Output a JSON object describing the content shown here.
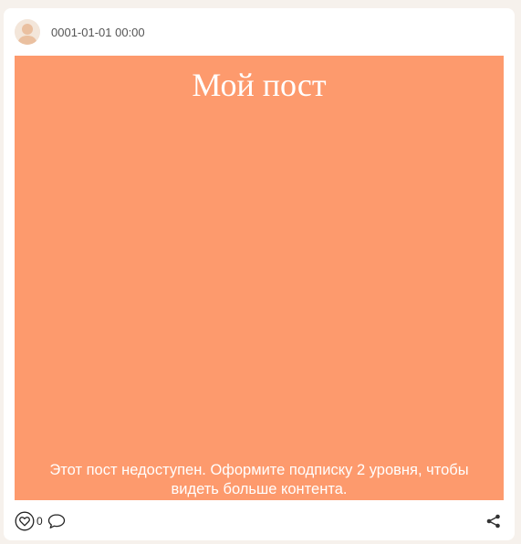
{
  "post": {
    "timestamp": "0001-01-01 00:00",
    "title": "Мой пост",
    "locked_message": "Этот пост недоступен. Оформите подписку 2 уровня, чтобы видеть больше контента.",
    "likes_count": "0",
    "background_color": "#fd9a6d"
  },
  "icons": {
    "avatar": "user-avatar-icon",
    "like": "heart-icon",
    "comment": "comment-icon",
    "share": "share-icon"
  }
}
